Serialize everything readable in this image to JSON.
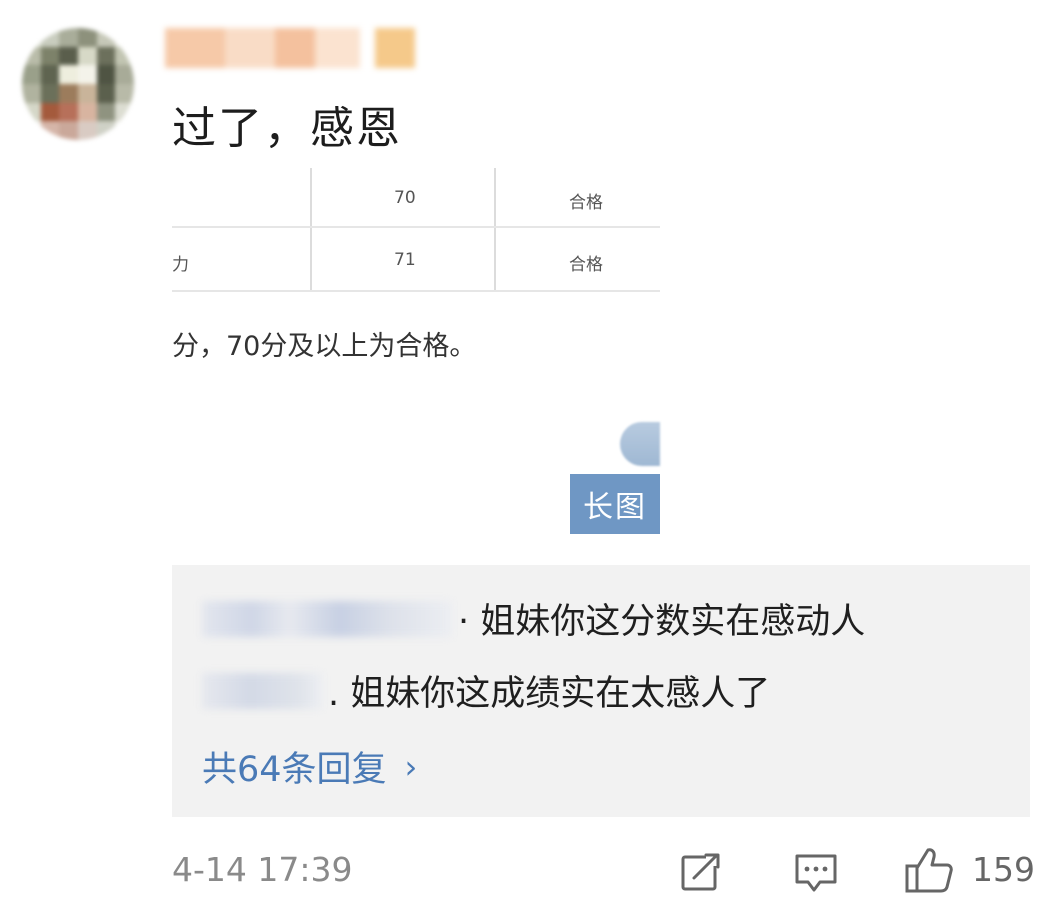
{
  "post": {
    "text": "过了，感恩",
    "table": {
      "rows": [
        {
          "label": "",
          "score": "70",
          "result": "合格"
        },
        {
          "label": "力",
          "score": "71",
          "result": "合格"
        }
      ],
      "note": "分，70分及以上为合格。"
    },
    "long_image_badge": "长图"
  },
  "replies": [
    {
      "text": "· 姐妹你这分数实在感动人"
    },
    {
      "text": ". 姐妹你这成绩实在太感人了"
    }
  ],
  "reply_count_label": "共64条回复",
  "footer": {
    "timestamp": "4-14 17:39",
    "like_count": "159",
    "icons": [
      "share-icon",
      "comment-icon",
      "like-icon"
    ]
  },
  "colors": {
    "link": "#4a7ab6",
    "badge_bg": "#6f97c4",
    "reply_bg": "#f2f2f2",
    "meta_text": "#8a8a8a"
  }
}
